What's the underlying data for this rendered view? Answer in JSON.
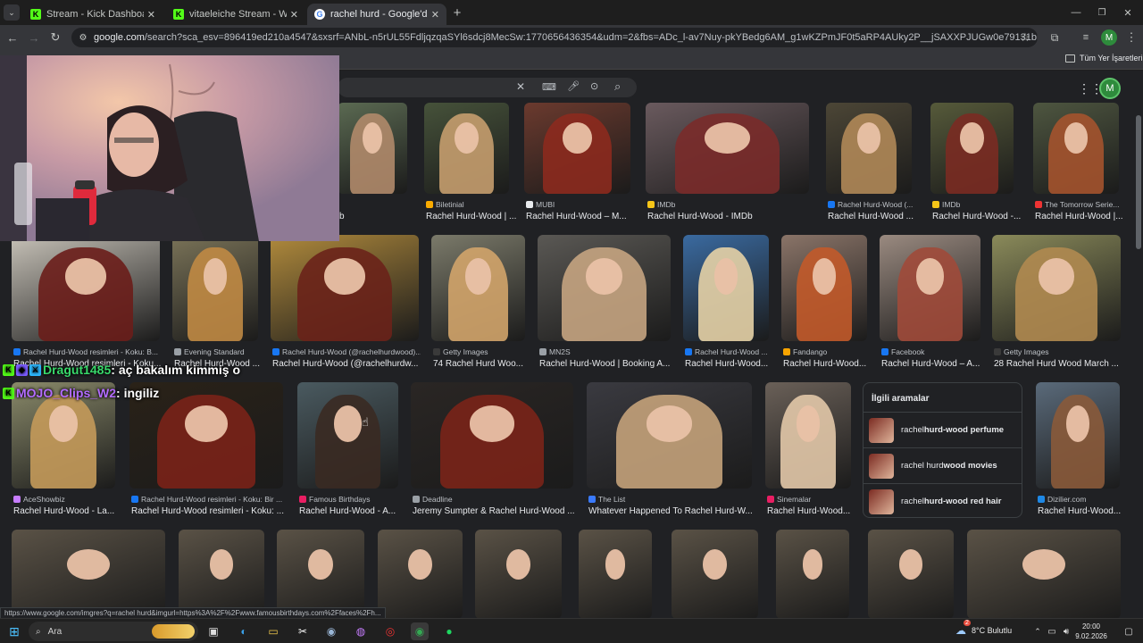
{
  "tabs": [
    {
      "title": "Stream - Kick Dashboard",
      "icon": "kick-icon"
    },
    {
      "title": "vitaeleiche Stream - Watch Live",
      "icon": "kick-icon"
    },
    {
      "title": "rachel hurd - Google'da Ara",
      "icon": "google-icon"
    }
  ],
  "new_tab_label": "+",
  "url_host": "google.com",
  "url_rest": "/search?sca_esv=896419ed210a4547&sxsrf=ANbL-n5rUL55FdljqzqaSYl6sdcj8MecSw:1770656436354&udm=2&fbs=ADc_l-av7Nuy-pkYBedg6AM_g1wKZPmJF0t5aRP4AUky2P__jSAXXPJUGw0e79131bHRu5vWTbF2aoFlcUH8LO92vcJatSGfQ...",
  "profile_letter": "M",
  "bookmarks_label": "Tüm Yer İşaretleri",
  "status_url": "https://www.google.com/imgres?q=rachel hurd&imgurl=https%3A%2F%2Fwww.famousbirthdays.com%2Ffaces%2Fh...",
  "results": [
    {
      "src": "",
      "cap": "b"
    },
    {
      "src": "Biletinial",
      "cap": "Rachel Hurd-Wood | ..."
    },
    {
      "src": "MUBI",
      "cap": "Rachel Hurd-Wood – M..."
    },
    {
      "src": "IMDb",
      "cap": "Rachel Hurd-Wood - IMDb"
    },
    {
      "src": "Rachel Hurd-Wood (...",
      "cap": "Rachel Hurd-Wood ..."
    },
    {
      "src": "IMDb",
      "cap": "Rachel Hurd-Wood -..."
    },
    {
      "src": "The Tomorrow Serie...",
      "cap": "Rachel Hurd-Wood |..."
    },
    {
      "src": "Rachel Hurd-Wood resimleri - Koku: B...",
      "cap": "Rachel Hurd-Wood resimleri - Koku..."
    },
    {
      "src": "Evening Standard",
      "cap": "Rachel Hurd-Wood ..."
    },
    {
      "src": "Rachel Hurd-Wood (@rachelhurdwood)...",
      "cap": "Rachel Hurd-Wood (@rachelhurdw..."
    },
    {
      "src": "Getty Images",
      "cap": "74 Rachel Hurd Woo..."
    },
    {
      "src": "MN2S",
      "cap": "Rachel Hurd-Wood | Booking A..."
    },
    {
      "src": "Rachel Hurd-Wood ...",
      "cap": "Rachel Hurd-Wood..."
    },
    {
      "src": "Fandango",
      "cap": "Rachel Hurd-Wood..."
    },
    {
      "src": "Facebook",
      "cap": "Rachel Hurd-Wood – A..."
    },
    {
      "src": "Getty Images",
      "cap": "28 Rachel Hurd Wood March ..."
    },
    {
      "src": "AceShowbiz",
      "cap": "Rachel Hurd-Wood - La..."
    },
    {
      "src": "Rachel Hurd-Wood resimleri - Koku: Bir ...",
      "cap": "Rachel Hurd-Wood resimleri - Koku: ..."
    },
    {
      "src": "Famous Birthdays",
      "cap": "Rachel Hurd-Wood - A..."
    },
    {
      "src": "Deadline",
      "cap": "Jeremy Sumpter & Rachel Hurd-Wood ..."
    },
    {
      "src": "The List",
      "cap": "Whatever Happened To Rachel Hurd-W..."
    },
    {
      "src": "Sinemalar",
      "cap": "Rachel Hurd-Wood..."
    },
    {
      "src": "Dizilier.com",
      "cap": "Rachel Hurd-Wood..."
    }
  ],
  "related": {
    "title": "İlgili aramalar",
    "items": [
      {
        "plain": "rachel ",
        "bold": "hurd-wood perfume"
      },
      {
        "plain": "rachel hurd ",
        "bold": "wood movies"
      },
      {
        "plain": "rachel ",
        "bold": "hurd-wood red hair"
      }
    ]
  },
  "chat": [
    {
      "user": "Dragut1485",
      "msg": " : aç bakalım kimmiş o",
      "color": "#38d96a"
    },
    {
      "user": "MOJO_Clips_W2",
      "msg": " : ingiliz",
      "color": "#b36cff"
    }
  ],
  "taskbar": {
    "search_placeholder": "Ara",
    "weather": "8°C  Bulutlu",
    "weather_badge": "2",
    "time": "20:00",
    "date": "9.02.2026"
  }
}
